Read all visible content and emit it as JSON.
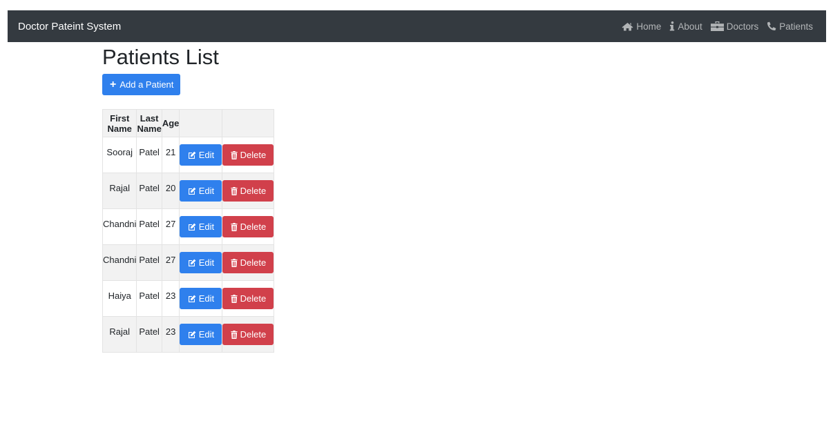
{
  "navbar": {
    "brand": "Doctor Pateint System",
    "links": [
      {
        "label": "Home",
        "icon": "home-icon"
      },
      {
        "label": "About",
        "icon": "info-icon"
      },
      {
        "label": "Doctors",
        "icon": "briefcase-icon"
      },
      {
        "label": "Patients",
        "icon": "phone-icon"
      }
    ]
  },
  "page": {
    "title": "Patients List",
    "add_button_label": "Add a Patient"
  },
  "table": {
    "headers": [
      "First Name",
      "Last Name",
      "Age",
      "",
      ""
    ],
    "edit_label": "Edit",
    "delete_label": "Delete",
    "rows": [
      {
        "first_name": "Sooraj",
        "last_name": "Patel",
        "age": "21"
      },
      {
        "first_name": "Rajal",
        "last_name": "Patel",
        "age": "20"
      },
      {
        "first_name": "Chandni",
        "last_name": "Patel",
        "age": "27"
      },
      {
        "first_name": "Chandni",
        "last_name": "Patel",
        "age": "27"
      },
      {
        "first_name": "Haiya",
        "last_name": "Patel",
        "age": "23"
      },
      {
        "first_name": "Rajal",
        "last_name": "Patel",
        "age": "23"
      }
    ]
  },
  "colors": {
    "navbar_bg": "#343a40",
    "primary": "#2f80ed",
    "danger": "#d1404b",
    "striped_row": "#f2f2f2"
  }
}
